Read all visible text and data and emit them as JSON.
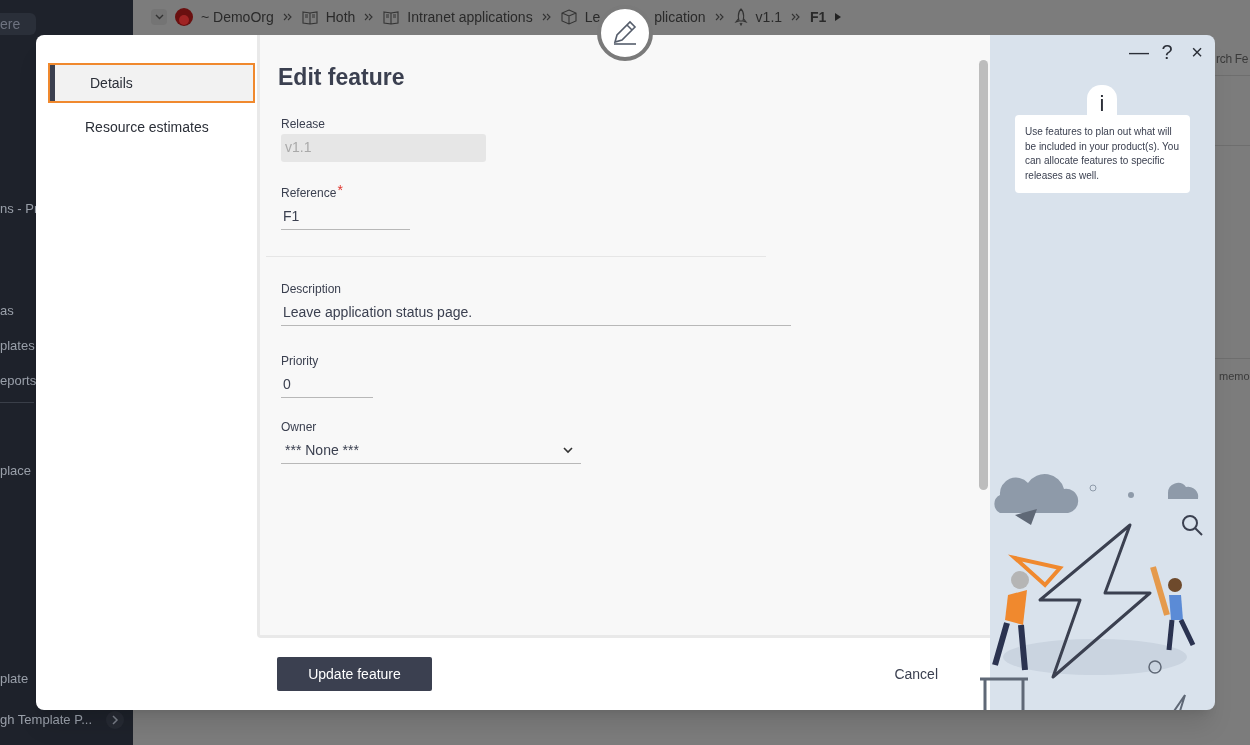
{
  "app_sidebar": {
    "search_placeholder": "ere",
    "items": [
      {
        "text": "ns - Pr"
      },
      {
        "text": "as"
      },
      {
        "text": "plates"
      },
      {
        "text": "eports"
      },
      {
        "text": "place"
      },
      {
        "text": "plate"
      },
      {
        "text": "gh Template P..."
      }
    ]
  },
  "breadcrumb": [
    {
      "kind": "org",
      "text": "~ DemoOrg"
    },
    {
      "kind": "book",
      "text": "Hoth"
    },
    {
      "kind": "book",
      "text": "Intranet applications"
    },
    {
      "kind": "box",
      "text": "Le",
      "text_after_cover": "plication"
    },
    {
      "kind": "rocket",
      "text": "v1.1"
    },
    {
      "kind": "current",
      "text": "F1"
    }
  ],
  "background_texts": [
    "rch Fe",
    "memo"
  ],
  "dialog": {
    "nav": [
      {
        "label": "Details",
        "selected": true
      },
      {
        "label": "Resource estimates",
        "selected": false
      }
    ],
    "title": "Edit feature",
    "fields": [
      {
        "kind": "disabled",
        "label": "Release",
        "value": "v1.1"
      },
      {
        "kind": "text",
        "label": "Reference",
        "value": "F1",
        "required_mark": "*"
      },
      {
        "kind": "divider"
      },
      {
        "kind": "text",
        "label": "Description",
        "value": "Leave application status page."
      },
      {
        "kind": "text",
        "label": "Priority",
        "value": "0"
      },
      {
        "kind": "select",
        "label": "Owner",
        "value": "*** None ***"
      }
    ],
    "primary_button": "Update feature",
    "cancel_button": "Cancel",
    "window_controls": [
      "—",
      "?",
      "×"
    ],
    "info": {
      "icon": "i",
      "text": "Use features to plan out what will be included in your product(s). You can allocate features to specific releases as well."
    }
  }
}
